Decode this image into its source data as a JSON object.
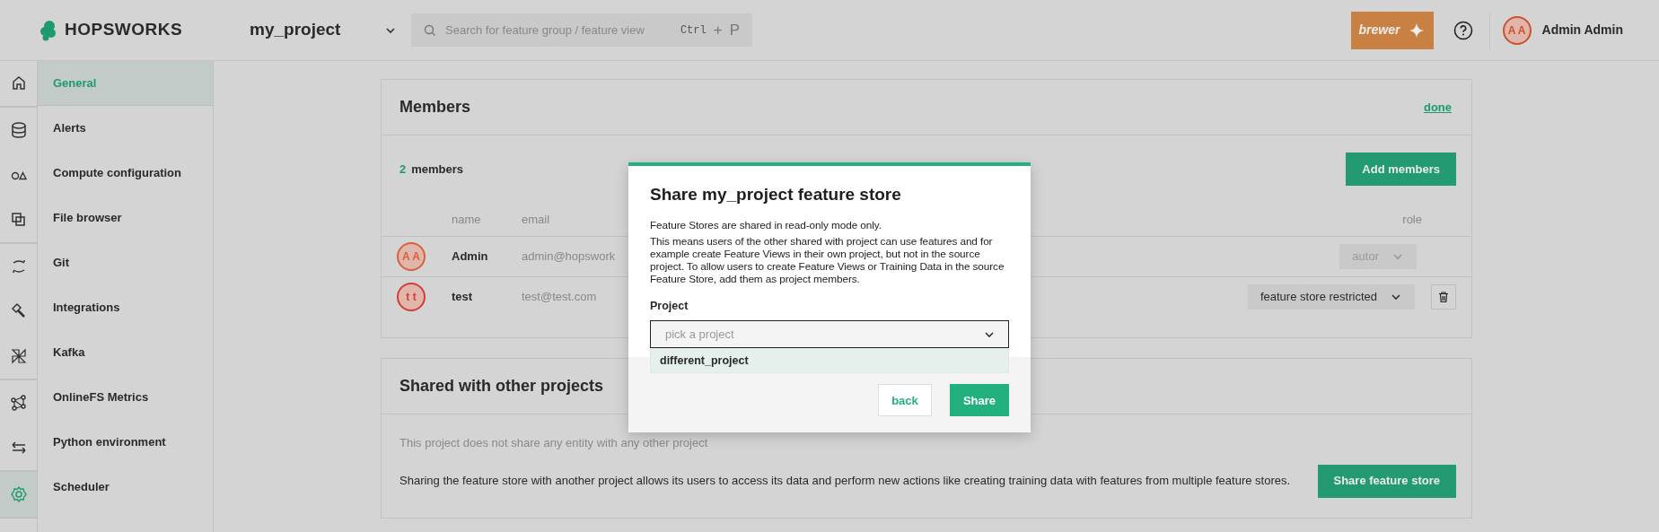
{
  "header": {
    "logo": "HOPSWORKS",
    "project": "my_project",
    "search": {
      "placeholder": "Search for feature group / feature view",
      "shortcut": [
        "Ctrl",
        "+",
        "P"
      ]
    },
    "assistant_button": "brewer",
    "user": {
      "initials": "A A",
      "name": "Admin Admin"
    }
  },
  "rail_groups": [
    {
      "items": [
        {
          "kind": "home",
          "selected": false
        }
      ]
    },
    {
      "items": [
        {
          "kind": "database",
          "selected": false
        },
        {
          "kind": "shapes",
          "selected": false
        },
        {
          "kind": "copy",
          "selected": false
        }
      ]
    },
    {
      "items": [
        {
          "kind": "sync",
          "selected": false
        },
        {
          "kind": "hammer",
          "selected": false
        },
        {
          "kind": "pinwheel",
          "selected": false
        }
      ]
    },
    {
      "items": [
        {
          "kind": "graph",
          "selected": false
        },
        {
          "kind": "swap",
          "selected": false
        }
      ]
    },
    {
      "items": [
        {
          "kind": "gear",
          "selected": true
        }
      ]
    }
  ],
  "menu": [
    {
      "label": "General",
      "selected": true
    },
    {
      "label": "Alerts",
      "selected": false
    },
    {
      "label": "Compute configuration",
      "selected": false
    },
    {
      "label": "File browser",
      "selected": false
    },
    {
      "label": "Git",
      "selected": false
    },
    {
      "label": "Integrations",
      "selected": false
    },
    {
      "label": "Kafka",
      "selected": false
    },
    {
      "label": "OnlineFS Metrics",
      "selected": false
    },
    {
      "label": "Python environment",
      "selected": false
    },
    {
      "label": "Scheduler",
      "selected": false
    }
  ],
  "members": {
    "title": "Members",
    "action": "done",
    "count": "2",
    "count_label": "members",
    "add_button": "Add members",
    "columns": [
      "name",
      "email",
      "role"
    ],
    "rows": [
      {
        "initials": "A A",
        "color": "#d9603b",
        "name": "Admin",
        "email": "admin@hopswork",
        "role": "autor",
        "role_disabled": true,
        "deletable": false
      },
      {
        "initials": "t t",
        "color": "#d63b3b",
        "name": "test",
        "email": "test@test.com",
        "role": "feature store restricted",
        "role_disabled": false,
        "deletable": true
      }
    ]
  },
  "shared": {
    "title": "Shared with other projects",
    "empty_text": "This project does not share any entity with any other project",
    "description": "Sharing the feature store with another project allows its users to access its data and perform new actions like creating training data with features from multiple feature stores.",
    "button": "Share feature store"
  },
  "dialog": {
    "title": "Share my_project feature store",
    "intro": "Feature Stores are shared in read-only mode only.",
    "body": "This means users of the other shared with project can use features and for example create Feature Views in their own project, but not in the source project. To allow users to create Feature Views or Training Data in the source Feature Store, add them as project members.",
    "field_label": "Project",
    "placeholder": "pick a project",
    "options": [
      {
        "label": "different_project",
        "highlighted": true
      }
    ],
    "buttons": [
      {
        "label": "back",
        "kind": "secondary"
      },
      {
        "label": "Share",
        "kind": "primary"
      }
    ]
  }
}
